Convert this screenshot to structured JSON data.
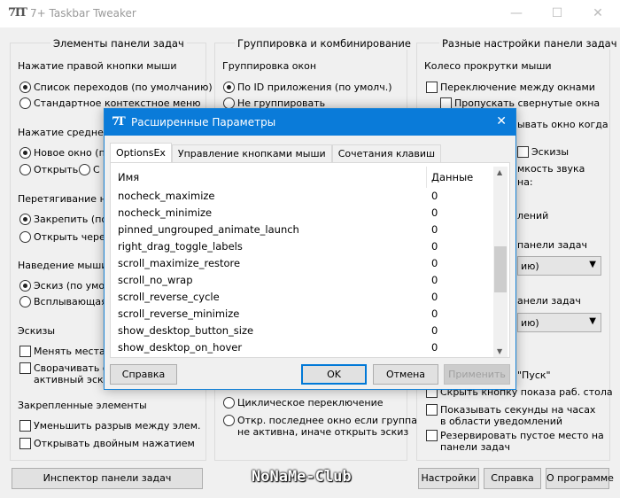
{
  "window": {
    "title": "7+ Taskbar Tweaker",
    "icon": "7TT"
  },
  "groups": {
    "left": {
      "title": "Элементы панели задач",
      "right_click_label": "Нажатие правой кнопки мыши",
      "right_click_options": [
        "Список переходов (по умолчанию)",
        "Стандартное контекстное меню"
      ],
      "middle_click_label": "Нажатие средней к",
      "middle_click_options": [
        "Новое окно (по",
        "Открыть",
        "С"
      ],
      "drag_label": "Перетягивание на",
      "drag_options": [
        "Закрепить (по у",
        "Открыть через"
      ],
      "hover_label": "Наведение мыши н",
      "hover_options": [
        "Эскиз (по умолч",
        "Всплывающая п"
      ],
      "thumbs_label": "Эскизы",
      "thumbs_options": [
        "Менять местами",
        "Сворачивать ок",
        "активный эскиз"
      ],
      "pinned_label": "Закрепленные элементы",
      "pinned_options": [
        "Уменьшить разрыв между элем.",
        "Открывать двойным нажатием"
      ]
    },
    "middle": {
      "title": "Группировка и комбинирование",
      "grouping_label": "Группировка окон",
      "grouping_options": [
        "По ID приложения (по умолч.)",
        "Не группировать"
      ],
      "bottom_options": [
        "Циклическое переключение",
        "Откр. последнее окно если группа",
        "не активна, иначе открыть эскиз"
      ]
    },
    "right": {
      "title": "Разные настройки панели задач",
      "wheel_label": "Колесо прокрутки мыши",
      "wheel_options": [
        "Переключение между окнами",
        "Пропускать свернутые окна",
        "ывать окно когда",
        "Эскизы",
        "мкость звука",
        "на:",
        "лений"
      ],
      "panel_label": "панели задач",
      "panel2_label": "анели задач",
      "combo1": "ию)",
      "combo2": "ию)",
      "start_label": "\"Пуск\"",
      "bottom_options": [
        "Скрыть кнопку показа раб. стола",
        "Показывать секунды на часах",
        "в области уведомлений",
        "Резервировать пустое место на",
        "панели задач"
      ]
    }
  },
  "footer": {
    "inspector_button": "Инспектор панели задач",
    "settings_button": "Настройки",
    "help_button": "Справка",
    "about_button": "О программе",
    "watermark": "NoNaMe-Club"
  },
  "dialog": {
    "title": "Расширенные Параметры",
    "close": "✕",
    "tabs": [
      "OptionsEx",
      "Управление кнопками мыши",
      "Сочетания клавиш"
    ],
    "columns": [
      "Имя",
      "Данные"
    ],
    "rows": [
      {
        "name": "nocheck_maximize",
        "value": "0"
      },
      {
        "name": "nocheck_minimize",
        "value": "0"
      },
      {
        "name": "pinned_ungrouped_animate_launch",
        "value": "0"
      },
      {
        "name": "right_drag_toggle_labels",
        "value": "0"
      },
      {
        "name": "scroll_maximize_restore",
        "value": "0"
      },
      {
        "name": "scroll_no_wrap",
        "value": "0"
      },
      {
        "name": "scroll_reverse_cycle",
        "value": "0"
      },
      {
        "name": "scroll_reverse_minimize",
        "value": "0"
      },
      {
        "name": "show_desktop_button_size",
        "value": "0"
      },
      {
        "name": "show_desktop_on_hover",
        "value": "0"
      }
    ],
    "help_button": "Справка",
    "ok_button": "OK",
    "cancel_button": "Отмена",
    "apply_button": "Применить"
  },
  "colors": {
    "accent": "#0a7bd9",
    "window_bg": "#f0f0f0"
  }
}
